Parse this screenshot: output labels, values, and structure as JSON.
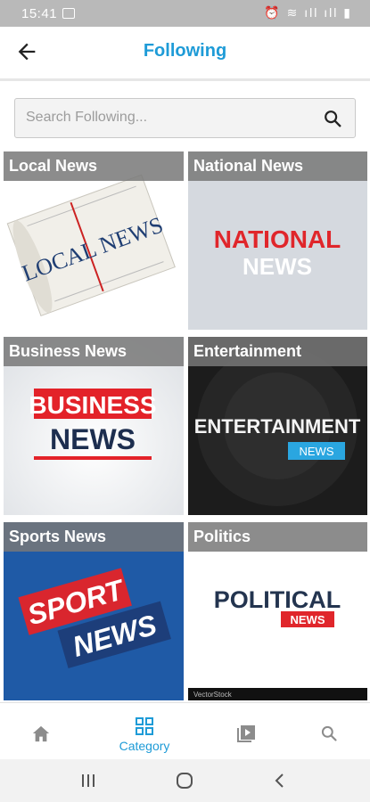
{
  "status_bar": {
    "time": "15:41",
    "right_icons": "⏰ ≋ ıll ıll ▮"
  },
  "header": {
    "title": "Following"
  },
  "search": {
    "placeholder": "Search Following..."
  },
  "categories": [
    {
      "label": "Local News",
      "image_text": "LOCAL NEWS"
    },
    {
      "label": "National News",
      "image_text_1": "NATIONAL",
      "image_text_2": "NEWS"
    },
    {
      "label": "Business News",
      "image_text_1": "BUSINESS",
      "image_text_2": "NEWS"
    },
    {
      "label": "Entertainment",
      "image_text_1": "ENTERTAINMENT",
      "image_text_2": "NEWS"
    },
    {
      "label": "Sports News",
      "image_text_1": "SPORT",
      "image_text_2": "NEWS"
    },
    {
      "label": "Politics",
      "image_text_1": "POLITICAL",
      "image_text_2": "NEWS",
      "watermark": "VectorStock"
    }
  ],
  "bottom_nav": {
    "active_label": "Category"
  },
  "colors": {
    "accent": "#1e9bd7",
    "status_bar": "#b9b9b9",
    "label_overlay": "#787878"
  }
}
